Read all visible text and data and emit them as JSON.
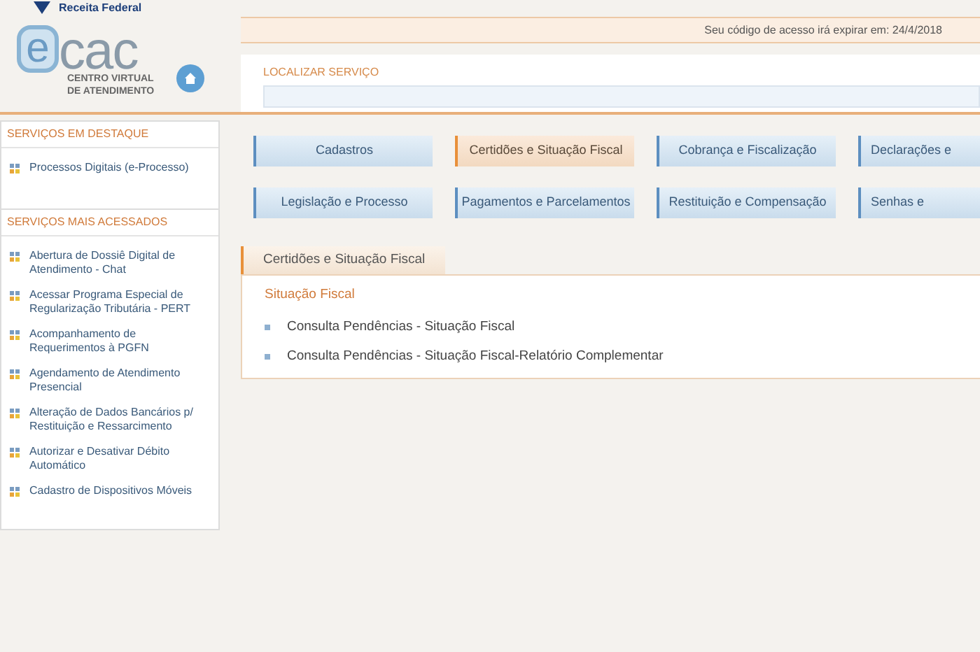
{
  "brand": {
    "agency": "Receita Federal",
    "logo_e": "e",
    "logo_rest": "cac",
    "subtitle_1": "CENTRO VIRTUAL",
    "subtitle_2": "DE ATENDIMENTO"
  },
  "notice": "Seu código de acesso irá expirar em: 24/4/2018",
  "search": {
    "label": "LOCALIZAR SERVIÇO"
  },
  "sidebar": [
    {
      "title": "SERVIÇOS EM DESTAQUE",
      "items": [
        "Processos Digitais (e-Processo)"
      ]
    },
    {
      "title": "SERVIÇOS MAIS ACESSADOS",
      "items": [
        "Abertura de Dossiê Digital de Atendimento - Chat",
        "Acessar Programa Especial de Regularização Tributária - PERT",
        "Acompanhamento de Requerimentos à PGFN",
        "Agendamento de Atendimento Presencial",
        "Alteração de Dados Bancários p/ Restituição e Ressarcimento",
        "Autorizar e Desativar Débito Automático",
        "Cadastro de Dispositivos Móveis"
      ]
    }
  ],
  "categories": [
    {
      "label": "Cadastros",
      "selected": false
    },
    {
      "label": "Certidões e Situação Fiscal",
      "selected": true
    },
    {
      "label": "Cobrança e Fiscalização",
      "selected": false
    },
    {
      "label": "Declarações e",
      "selected": false
    },
    {
      "label": "Legislação e Processo",
      "selected": false
    },
    {
      "label": "Pagamentos e Parcelamentos",
      "selected": false
    },
    {
      "label": "Restituição e Compensação",
      "selected": false
    },
    {
      "label": "Senhas e",
      "selected": false
    }
  ],
  "panel": {
    "tab": "Certidões e Situação Fiscal",
    "heading": "Situação Fiscal",
    "links": [
      "Consulta Pendências - Situação Fiscal",
      "Consulta Pendências - Situação Fiscal-Relatório Complementar"
    ]
  }
}
